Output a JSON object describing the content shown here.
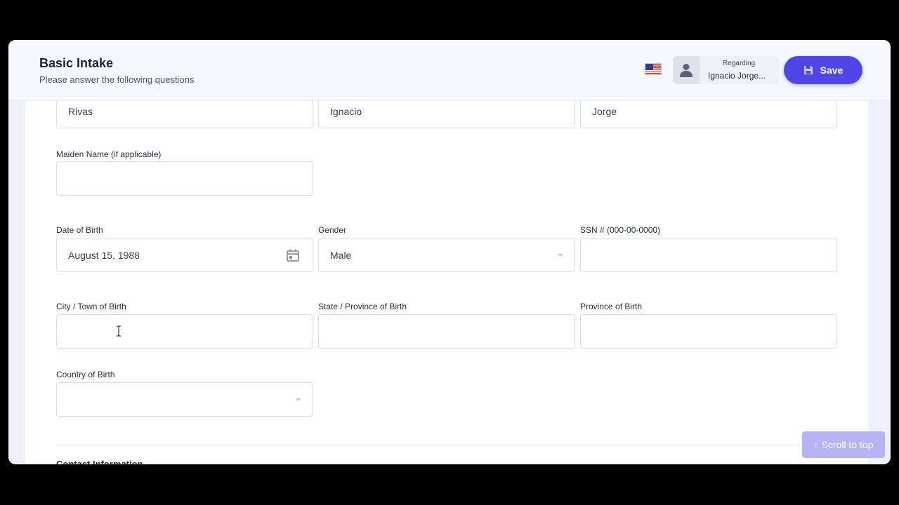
{
  "header": {
    "title": "Basic Intake",
    "subtitle": "Please answer the following questions",
    "flag_icon": "us-flag-icon",
    "regarding_label": "Regarding",
    "regarding_name": "Ignacio Jorge...",
    "save_label": "Save"
  },
  "form": {
    "last_name": "Rivas",
    "first_name": "Ignacio",
    "middle_name": "Jorge",
    "maiden_name": {
      "label": "Maiden Name (if applicable)",
      "value": ""
    },
    "dob": {
      "label": "Date of Birth",
      "value": "August 15, 1988"
    },
    "gender": {
      "label": "Gender",
      "value": "Male"
    },
    "ssn": {
      "label": "SSN # (000-00-0000)",
      "value": ""
    },
    "city_birth": {
      "label": "City / Town of Birth",
      "value": ""
    },
    "state_birth": {
      "label": "State / Province of Birth",
      "value": ""
    },
    "province_birth": {
      "label": "Province of Birth",
      "value": ""
    },
    "country_birth": {
      "label": "Country of Birth",
      "value": ""
    },
    "next_section": "Contact Information"
  },
  "scroll_top_label": "Scroll to top",
  "colors": {
    "accent": "#4f46e5",
    "scroll_top": "#b7b4f5"
  }
}
